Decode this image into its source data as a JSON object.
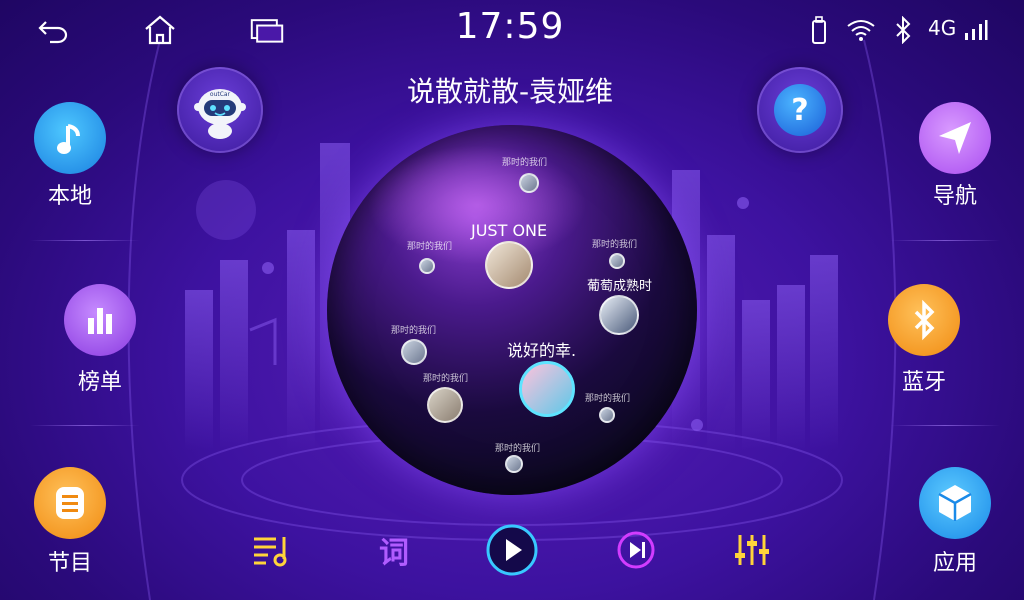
{
  "status": {
    "time": "17:59",
    "network": "4G",
    "icons": [
      "back-icon",
      "home-icon",
      "recent-apps-icon",
      "usb-icon",
      "wifi-icon",
      "bluetooth-icon",
      "signal-icon"
    ]
  },
  "player": {
    "song_title": "说散就散-袁娅维"
  },
  "sidebar_left": {
    "items": [
      {
        "label": "本地",
        "icon": "music-note-icon"
      },
      {
        "label": "榜单",
        "icon": "chart-bars-icon"
      },
      {
        "label": "节目",
        "icon": "program-list-icon"
      }
    ]
  },
  "sidebar_right": {
    "items": [
      {
        "label": "导航",
        "icon": "navigation-arrow-icon"
      },
      {
        "label": "蓝牙",
        "icon": "bluetooth-icon"
      },
      {
        "label": "应用",
        "icon": "apps-cube-icon"
      }
    ]
  },
  "header_buttons": {
    "robot_text": "outCar",
    "help_symbol": "?"
  },
  "sphere": {
    "featured": [
      {
        "label": "JUST ONE"
      },
      {
        "label": "葡萄成熟时"
      },
      {
        "label": "说好的幸."
      }
    ],
    "small_label": "那时的我们"
  },
  "controls": {
    "lyrics_label": "词",
    "colors": {
      "playlist": "#ffd43a",
      "lyrics": "#b15cff",
      "play": "#38c8ff",
      "next": "#d23cff",
      "eq": "#ffd43a"
    }
  },
  "colors": {
    "accent_blue": "#2aa8f0",
    "accent_purple": "#a94cf0",
    "accent_orange": "#f49a1c",
    "bg": "#3d12a0"
  }
}
